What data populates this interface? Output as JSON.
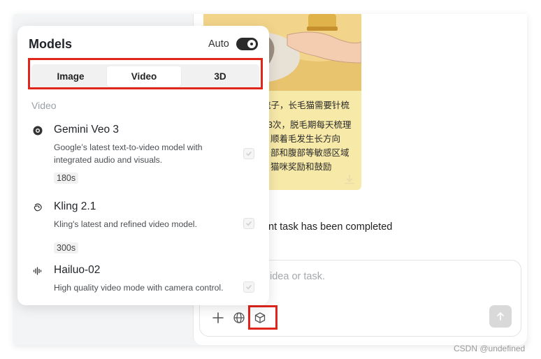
{
  "image_card": {
    "lines": [
      "梳子，长毛猫需要针梳",
      "3次，脱毛期每天梳理",
      "顺着毛发生长方向",
      "部和腹部等敏感区域",
      "猫咪奖励和鼓励"
    ]
  },
  "chat": {
    "status_text": "nt task has been completed"
  },
  "composer": {
    "placeholder": "idea or task."
  },
  "models_panel": {
    "title": "Models",
    "auto_label": "Auto",
    "auto_enabled": true,
    "tabs": [
      {
        "label": "Image",
        "active": false
      },
      {
        "label": "Video",
        "active": true
      },
      {
        "label": "3D",
        "active": false
      }
    ],
    "section_label": "Video",
    "items": [
      {
        "name": "Gemini Veo 3",
        "description": "Google’s latest text-to-video model with integrated audio and visuals.",
        "badge": "180s",
        "icon": "gemini-icon",
        "checked": true
      },
      {
        "name": "Kling 2.1",
        "description": "Kling's latest and refined video model.",
        "badge": "300s",
        "icon": "kling-icon",
        "checked": true
      },
      {
        "name": "Hailuo-02",
        "description": "High quality video mode with camera control.",
        "badge": "",
        "icon": "hailuo-icon",
        "checked": true
      }
    ]
  },
  "watermark": "CSDN @undefined",
  "colors": {
    "highlight": "#e0251b",
    "toggle_on": "#2b2b2b",
    "image_bg": "#f7e9a8"
  }
}
